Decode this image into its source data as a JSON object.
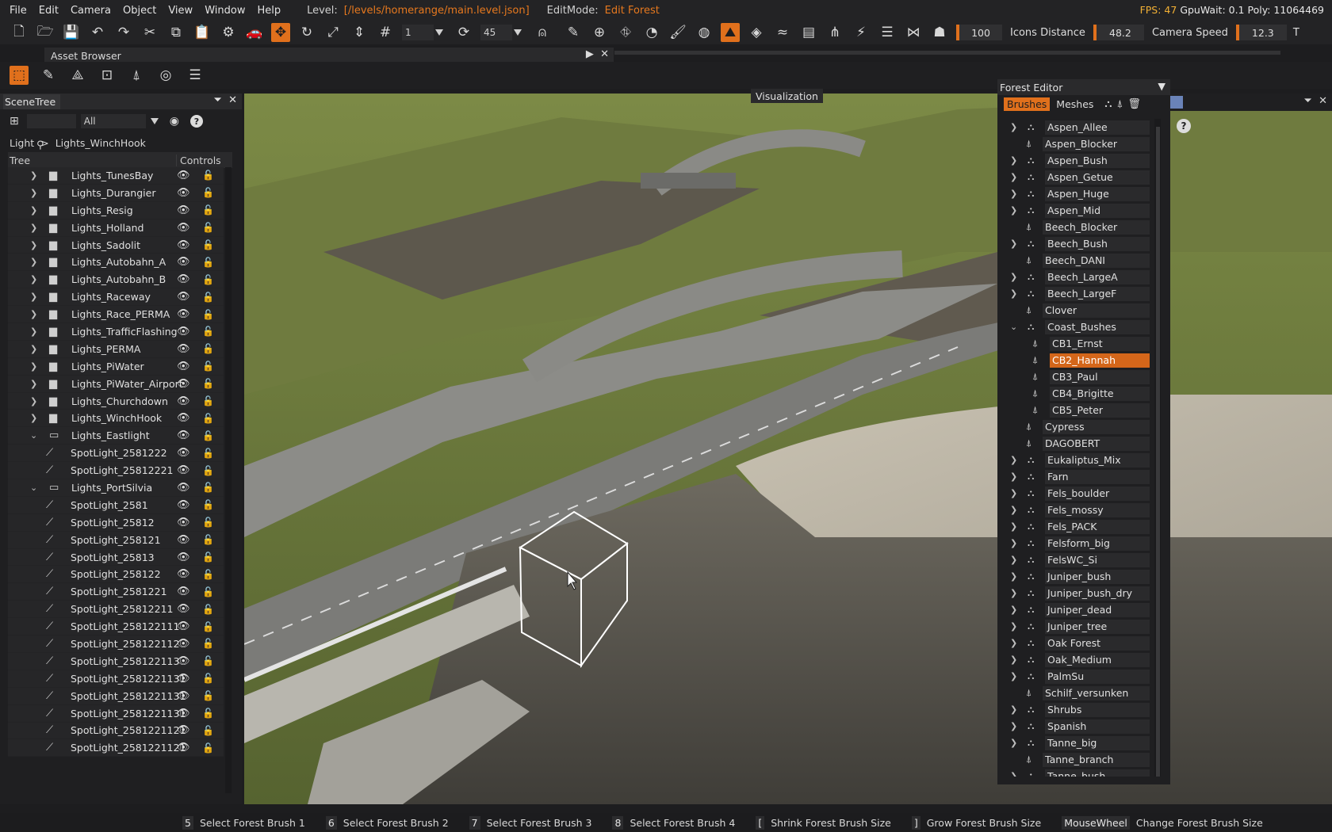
{
  "menu": {
    "items": [
      "File",
      "Edit",
      "Camera",
      "Object",
      "View",
      "Window",
      "Help"
    ],
    "level_label": "Level:",
    "level_path": "[/levels/homerange/main.level.json]",
    "editmode_label": "EditMode:",
    "editmode_value": "Edit Forest",
    "fps": "FPS: 47",
    "stats_rest": "GpuWait: 0.1  Poly: 11064469"
  },
  "toolbar": {
    "snap_value": "1",
    "rotate_snap_value": "45",
    "range_value": "100",
    "icons_distance_label": "Icons Distance",
    "icons_distance_value": "48.2",
    "camera_speed_label": "Camera Speed",
    "camera_speed_value": "12.3",
    "overflow_label": "T"
  },
  "asset_browser": {
    "title": "Asset Browser"
  },
  "scene_tree": {
    "title": "SceneTree",
    "filter_value": "All",
    "breadcrumb": [
      "Light",
      "Lights_WinchHook"
    ],
    "col_tree": "Tree",
    "col_controls": "Controls",
    "rows": [
      {
        "label": "Lights_TunesBay",
        "type": "group"
      },
      {
        "label": "Lights_Durangier",
        "type": "group"
      },
      {
        "label": "Lights_Resig",
        "type": "group"
      },
      {
        "label": "Lights_Holland",
        "type": "group"
      },
      {
        "label": "Lights_Sadolit",
        "type": "group"
      },
      {
        "label": "Lights_Autobahn_A",
        "type": "group"
      },
      {
        "label": "Lights_Autobahn_B",
        "type": "group"
      },
      {
        "label": "Lights_Raceway",
        "type": "group"
      },
      {
        "label": "Lights_Race_PERMA",
        "type": "group"
      },
      {
        "label": "Lights_TrafficFlashing",
        "type": "group"
      },
      {
        "label": "Lights_PERMA",
        "type": "group"
      },
      {
        "label": "Lights_PiWater",
        "type": "group"
      },
      {
        "label": "Lights_PiWater_Airport",
        "type": "group"
      },
      {
        "label": "Lights_Churchdown",
        "type": "group"
      },
      {
        "label": "Lights_WinchHook",
        "type": "group"
      },
      {
        "label": "Lights_Eastlight",
        "type": "open"
      },
      {
        "label": "SpotLight_2581222",
        "type": "child"
      },
      {
        "label": "SpotLight_25812221",
        "type": "child"
      },
      {
        "label": "Lights_PortSilvia",
        "type": "open"
      },
      {
        "label": "SpotLight_2581",
        "type": "child"
      },
      {
        "label": "SpotLight_25812",
        "type": "child"
      },
      {
        "label": "SpotLight_258121",
        "type": "child"
      },
      {
        "label": "SpotLight_25813",
        "type": "child"
      },
      {
        "label": "SpotLight_258122",
        "type": "child"
      },
      {
        "label": "SpotLight_2581221",
        "type": "child"
      },
      {
        "label": "SpotLight_25812211",
        "type": "child"
      },
      {
        "label": "SpotLight_258122111",
        "type": "child"
      },
      {
        "label": "SpotLight_258122112",
        "type": "child"
      },
      {
        "label": "SpotLight_258122113",
        "type": "child"
      },
      {
        "label": "SpotLight_2581221131",
        "type": "child"
      },
      {
        "label": "SpotLight_2581221131",
        "type": "child"
      },
      {
        "label": "SpotLight_2581221131",
        "type": "child"
      },
      {
        "label": "SpotLight_2581221121",
        "type": "child"
      },
      {
        "label": "SpotLight_2581221121",
        "type": "child"
      }
    ]
  },
  "viewport": {
    "title": "Visualization"
  },
  "forest_editor": {
    "title": "Forest Editor",
    "tab_brushes": "Brushes",
    "tab_meshes": "Meshes",
    "items": [
      {
        "label": "Aspen_Allee",
        "kind": "brush"
      },
      {
        "label": "Aspen_Blocker",
        "kind": "item"
      },
      {
        "label": "Aspen_Bush",
        "kind": "brush"
      },
      {
        "label": "Aspen_Getue",
        "kind": "brush"
      },
      {
        "label": "Aspen_Huge",
        "kind": "brush"
      },
      {
        "label": "Aspen_Mid",
        "kind": "brush"
      },
      {
        "label": "Beech_Blocker",
        "kind": "item"
      },
      {
        "label": "Beech_Bush",
        "kind": "brush"
      },
      {
        "label": "Beech_DANI",
        "kind": "item"
      },
      {
        "label": "Beech_LargeA",
        "kind": "brush"
      },
      {
        "label": "Beech_LargeF",
        "kind": "brush"
      },
      {
        "label": "Clover",
        "kind": "item"
      },
      {
        "label": "Coast_Bushes",
        "kind": "open"
      },
      {
        "label": "CB1_Ernst",
        "kind": "sub"
      },
      {
        "label": "CB2_Hannah",
        "kind": "sel"
      },
      {
        "label": "CB3_Paul",
        "kind": "sub"
      },
      {
        "label": "CB4_Brigitte",
        "kind": "sub"
      },
      {
        "label": "CB5_Peter",
        "kind": "sub"
      },
      {
        "label": "Cypress",
        "kind": "item"
      },
      {
        "label": "DAGOBERT",
        "kind": "item"
      },
      {
        "label": "Eukaliptus_Mix",
        "kind": "brush"
      },
      {
        "label": "Farn",
        "kind": "brush"
      },
      {
        "label": "Fels_boulder",
        "kind": "brush"
      },
      {
        "label": "Fels_mossy",
        "kind": "brush"
      },
      {
        "label": "Fels_PACK",
        "kind": "brush"
      },
      {
        "label": "Felsform_big",
        "kind": "brush"
      },
      {
        "label": "FelsWC_Si",
        "kind": "brush"
      },
      {
        "label": "Juniper_bush",
        "kind": "brush"
      },
      {
        "label": "Juniper_bush_dry",
        "kind": "brush"
      },
      {
        "label": "Juniper_dead",
        "kind": "brush"
      },
      {
        "label": "Juniper_tree",
        "kind": "brush"
      },
      {
        "label": "Oak Forest",
        "kind": "brush"
      },
      {
        "label": "Oak_Medium",
        "kind": "brush"
      },
      {
        "label": "PalmSu",
        "kind": "brush"
      },
      {
        "label": "Schilf_versunken",
        "kind": "item"
      },
      {
        "label": "Shrubs",
        "kind": "brush"
      },
      {
        "label": "Spanish",
        "kind": "brush"
      },
      {
        "label": "Tanne_big",
        "kind": "brush"
      },
      {
        "label": "Tanne_branch",
        "kind": "item"
      },
      {
        "label": "Tanne_bush",
        "kind": "brush"
      }
    ]
  },
  "status_bar": [
    {
      "key": "5",
      "action": "Select Forest Brush 1"
    },
    {
      "key": "6",
      "action": "Select Forest Brush 2"
    },
    {
      "key": "7",
      "action": "Select Forest Brush 3"
    },
    {
      "key": "8",
      "action": "Select Forest Brush 4"
    },
    {
      "key": "[",
      "action": "Shrink Forest Brush Size"
    },
    {
      "key": "]",
      "action": "Grow Forest Brush Size"
    },
    {
      "key": "MouseWheel",
      "action": "Change Forest Brush Size"
    }
  ],
  "colors": {
    "accent": "#e0701c",
    "selected": "#d4661a",
    "panel": "#1f1f21"
  }
}
